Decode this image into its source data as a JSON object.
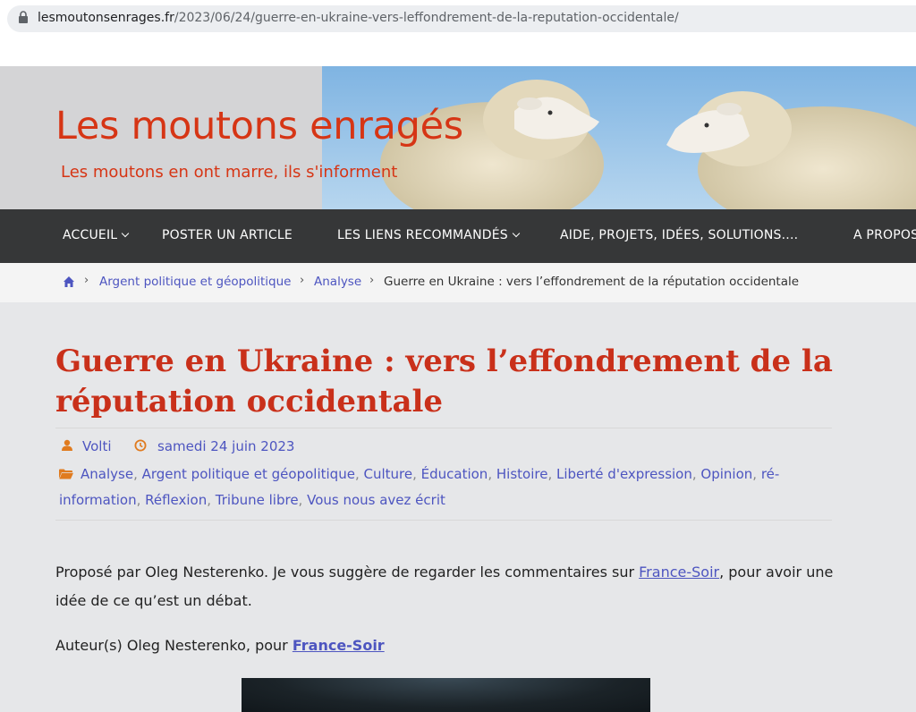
{
  "browser": {
    "url_domain": "lesmoutonsenrages.fr",
    "url_path": "/2023/06/24/guerre-en-ukraine-vers-leffondrement-de-la-reputation-occidentale/"
  },
  "header": {
    "site_title": "Les moutons enragés",
    "tagline": "Les moutons en ont marre, ils s'informent"
  },
  "nav": {
    "items": [
      {
        "label": "ACCUEIL"
      },
      {
        "label": "POSTER UN ARTICLE"
      },
      {
        "label": "LES LIENS RECOMMANDÉS"
      },
      {
        "label": "AIDE, PROJETS, IDÉES, SOLUTIONS...."
      },
      {
        "label": "A PROPOS"
      }
    ]
  },
  "breadcrumb": {
    "items": [
      "Argent politique et géopolitique",
      "Analyse"
    ],
    "current": "Guerre en Ukraine : vers l’effondrement de la réputation occidentale"
  },
  "article": {
    "title": "Guerre en Ukraine : vers l’effondrement de la réputation occidentale",
    "author": "Volti",
    "date": "samedi 24 juin 2023",
    "categories": [
      "Analyse",
      "Argent politique et géopolitique",
      "Culture",
      "Éducation",
      "Histoire",
      "Liberté d'expression",
      "Opinion",
      "ré-information",
      "Réflexion",
      "Tribune libre",
      "Vous nous avez écrit"
    ],
    "para1_before": "Proposé par Oleg Nesterenko. Je vous suggère de regarder les commentaires sur ",
    "para1_link": "France-Soir",
    "para1_after": ", pour avoir une idée de ce qu’est un débat.",
    "para2_before": "Auteur(s) Oleg Nesterenko, pour ",
    "para2_link": "France-Soir"
  },
  "colors": {
    "accent_red": "#d63515",
    "link_blue": "#4d55c0",
    "nav_bg": "#363738"
  }
}
